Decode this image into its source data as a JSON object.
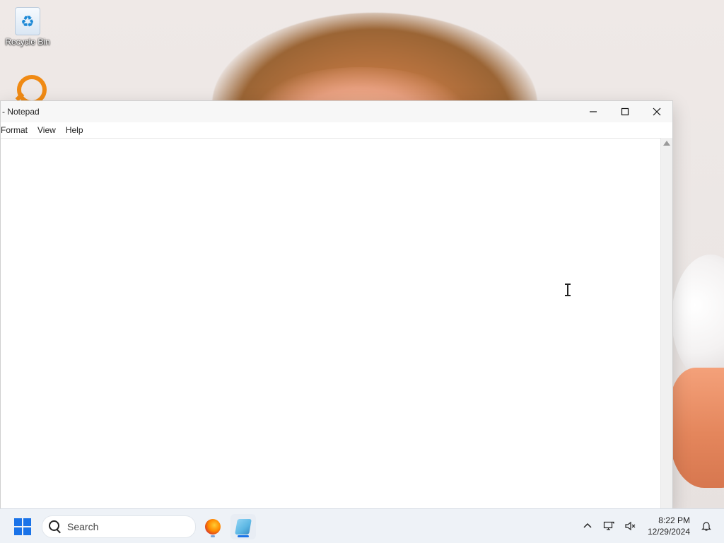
{
  "desktop": {
    "icons": [
      {
        "label": "Recycle Bin"
      },
      {
        "label": ""
      }
    ]
  },
  "window": {
    "title": "- Notepad",
    "menu": [
      "Format",
      "View",
      "Help"
    ],
    "editor_text": ""
  },
  "taskbar": {
    "search_placeholder": "Search",
    "apps": [
      "firefox-icon",
      "notepad-icon"
    ],
    "clock": {
      "time": "8:22 PM",
      "date": "12/29/2024"
    }
  },
  "colors": {
    "accent": "#1a73e8",
    "firefox_orange": "#ff8a00"
  }
}
